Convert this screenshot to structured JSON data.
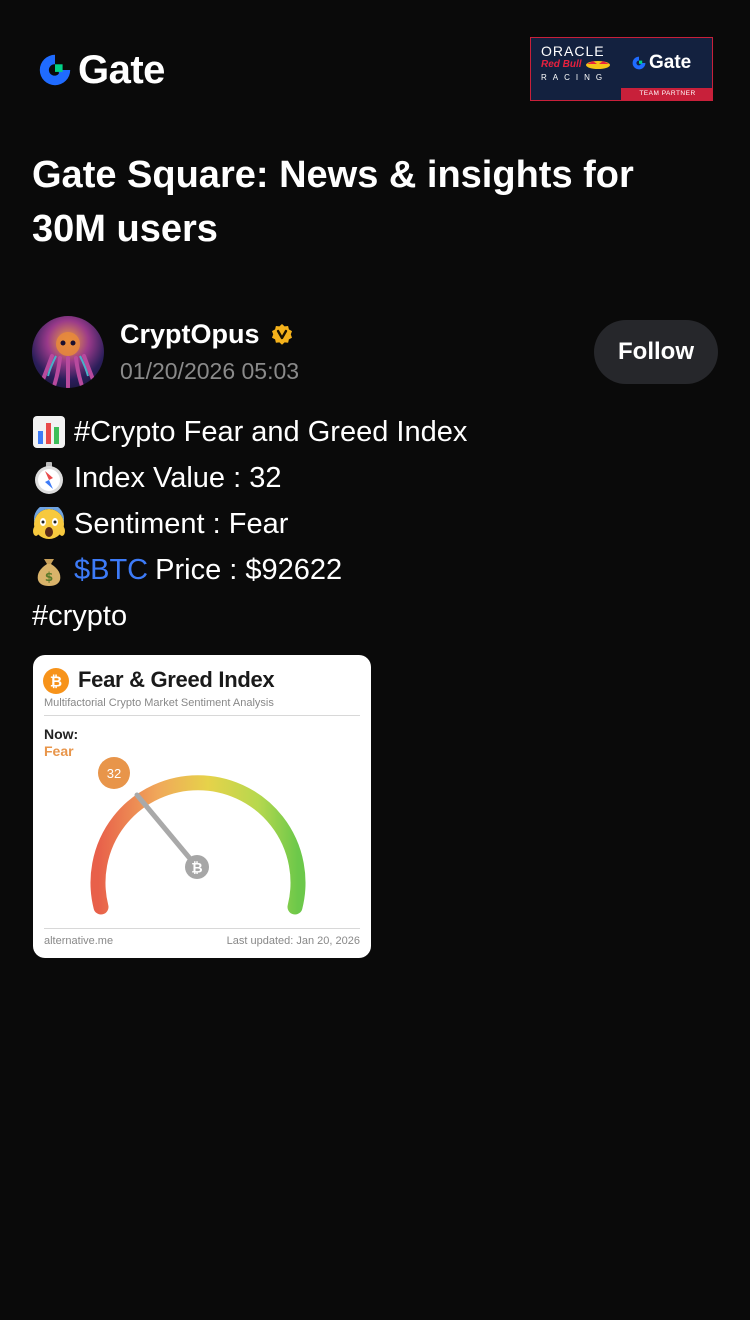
{
  "header": {
    "logo_text": "Gate",
    "partner": {
      "oracle": "ORACLE",
      "redbull": "Red Bull",
      "racing": "RACING",
      "gate": "Gate",
      "strip": "TEAM PARTNER"
    }
  },
  "title": "Gate Square: News & insights for 30M users",
  "author": {
    "name": "CryptOpus",
    "verified": true,
    "time": "01/20/2026 05:03",
    "follow_label": "Follow"
  },
  "post": {
    "line1": "#Crypto Fear and Greed Index",
    "line2": "Index Value : 32",
    "line3": "Sentiment : Fear",
    "line4_ticker": "$BTC",
    "line4_rest": "Price : $92622",
    "line5": "#crypto"
  },
  "card": {
    "title": "Fear & Greed Index",
    "subtitle": "Multifactorial Crypto Market Sentiment Analysis",
    "now_label": "Now:",
    "now_value": "Fear",
    "index_value": "32",
    "source": "alternative.me",
    "updated": "Last updated: Jan 20, 2026"
  },
  "colors": {
    "background": "#0a0a0a",
    "ticker": "#3d7bf7",
    "gate_blue": "#1f6bff",
    "gate_green": "#00d287",
    "verified": "#f5b21b",
    "fear_orange": "#e8954a"
  },
  "icons": [
    "gate-logo-icon",
    "verified-badge-icon",
    "bar-chart-emoji",
    "compass-emoji",
    "scream-emoji",
    "money-bag-emoji",
    "bitcoin-icon"
  ]
}
